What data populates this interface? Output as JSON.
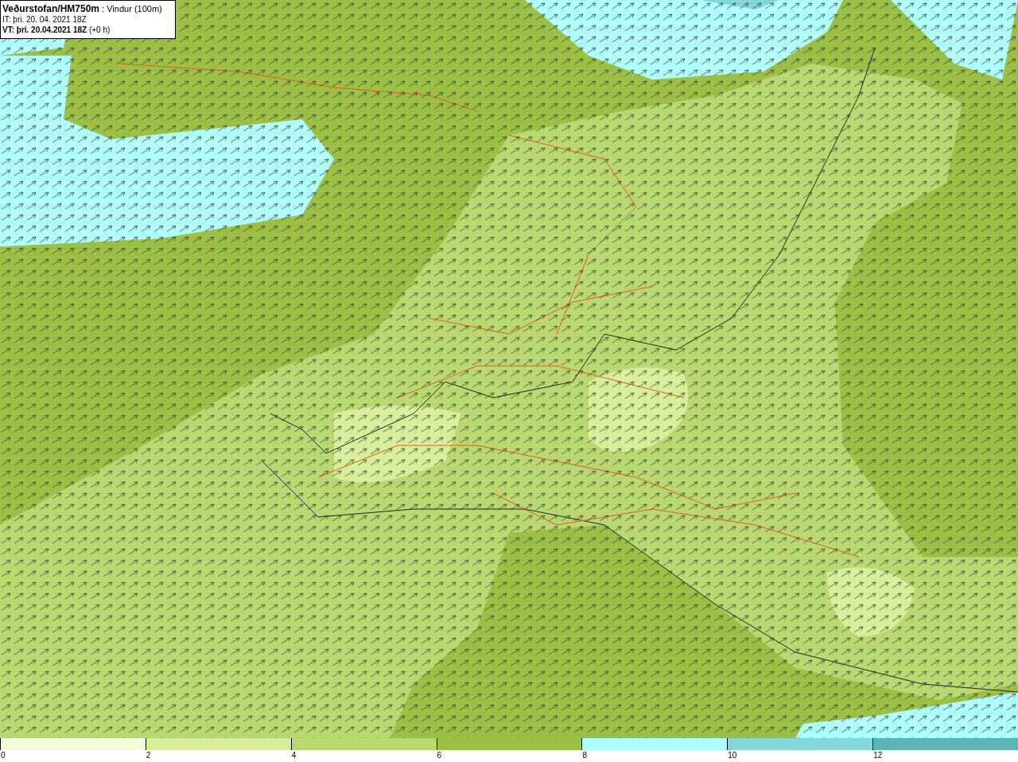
{
  "header": {
    "title": "Veðurstofan/HM750m",
    "variable": ": Vindur (100m)",
    "issue_time": "IT: þri. 20. 04. 2021 18Z",
    "valid_time": "VT: þri. 20.04.2021 18Z",
    "valid_offset": "(+0 h)"
  },
  "legend": [
    {
      "label": "0",
      "color": "#f5fedc"
    },
    {
      "label": "2",
      "color": "#d8ef9a"
    },
    {
      "label": "4",
      "color": "#b9d86e"
    },
    {
      "label": "6",
      "color": "#9cc044"
    },
    {
      "label": "8",
      "color": "#aefefe"
    },
    {
      "label": "10",
      "color": "#82d8d8"
    },
    {
      "label": "12",
      "color": "#5ab6b6"
    }
  ]
}
